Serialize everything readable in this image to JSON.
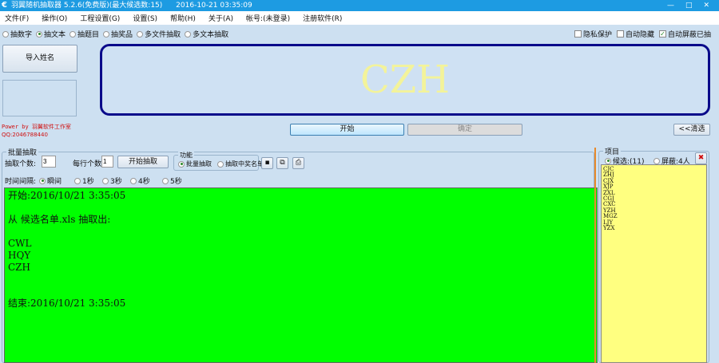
{
  "title": {
    "app": "羽翼随机抽取器 5.2.6(免费版)(最大候选数:15)",
    "datetime": "2016-10-21 03:35:09",
    "min": "—",
    "max": "□",
    "close": "✕"
  },
  "menu": [
    "文件(F)",
    "操作(O)",
    "工程设置(G)",
    "设置(S)",
    "帮助(H)",
    "关于(A)",
    "帐号:(未登录)",
    "注册软件(R)"
  ],
  "modes": [
    {
      "label": "抽数字",
      "on": false
    },
    {
      "label": "抽文本",
      "on": true
    },
    {
      "label": "抽题目",
      "on": false
    },
    {
      "label": "抽奖品",
      "on": false
    },
    {
      "label": "多文件抽取",
      "on": false
    },
    {
      "label": "多文本抽取",
      "on": false
    }
  ],
  "options": [
    {
      "label": "隐私保护",
      "checked": false
    },
    {
      "label": "自动隐藏",
      "checked": false
    },
    {
      "label": "自动屏蔽已抽",
      "checked": true
    }
  ],
  "import_button": "导入姓名",
  "powered": "Power by 羽翼软件工作室",
  "qq": "QQ:2046788440",
  "display": "CZH",
  "start_button": "开始",
  "confirm_button": "确定",
  "clear_button": "<<清选",
  "batch": {
    "group": "批量抽取",
    "count_label": "抽取个数:",
    "count": "3",
    "per_row_label": "每行个数:",
    "per_row": "1",
    "start_button": "开始抽取",
    "func_group": "功能",
    "func_batch": "批量抽取",
    "func_winners": "抽取中奖名单",
    "interval_label": "时间间隔:",
    "intervals": [
      "瞬间",
      "1秒",
      "3秒",
      "4秒",
      "5秒"
    ]
  },
  "output": "开始:2016/10/21 3:35:05\n\n从 候选名单.xls 抽取出:\n\nCWL\nHQY\nCZH\n\n\n结束:2016/10/21 3:35:05",
  "project": {
    "group": "项目",
    "candidates": "候选:(11)",
    "blocked": "屏蔽:4人",
    "items": [
      "CJC",
      "ZHJ",
      "CJX",
      "XJP",
      "ZXL",
      "CGJ",
      "CXC",
      "YZH",
      "MGZ",
      "LJY",
      "YZX"
    ]
  }
}
